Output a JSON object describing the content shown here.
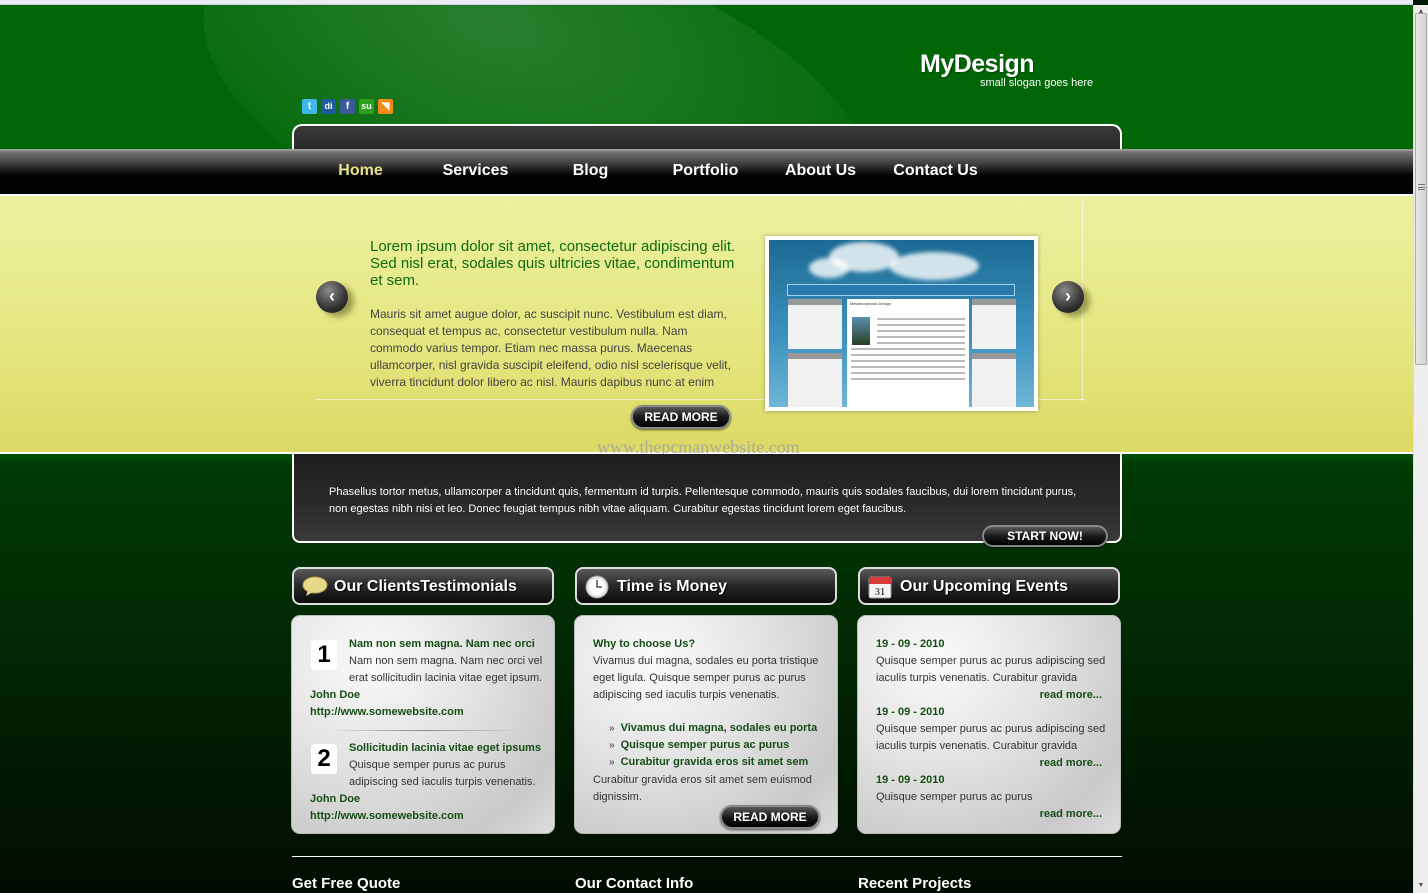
{
  "header": {
    "site_name": "MyDesign",
    "slogan": "small slogan goes here",
    "social_icons": [
      {
        "name": "twitter-icon",
        "glyph": "t",
        "color": "#3fb8e8"
      },
      {
        "name": "digg-icon",
        "glyph": "di",
        "color": "#1d5a9e"
      },
      {
        "name": "facebook-icon",
        "glyph": "f",
        "color": "#3b5998"
      },
      {
        "name": "stumbleupon-icon",
        "glyph": "su",
        "color": "#2f9f1e"
      },
      {
        "name": "rss-icon",
        "glyph": "◥",
        "color": "#f28b14"
      }
    ]
  },
  "nav": {
    "items": [
      {
        "label": "Home",
        "active": true
      },
      {
        "label": "Services"
      },
      {
        "label": "Blog"
      },
      {
        "label": "Portfolio"
      },
      {
        "label": "About Us"
      },
      {
        "label": "Contact Us"
      }
    ]
  },
  "slider": {
    "prev_icon": "‹",
    "next_icon": "›",
    "title": "Lorem ipsum dolor sit amet, consectetur adipiscing elit. Sed nisl erat, sodales quis ultricies vitae, condimentum et sem.",
    "body": "Mauris sit amet augue dolor, ac suscipit nunc. Vestibulum est diam, consequat et tempus ac, consectetur vestibulum nulla. Nam commodo varius tempor. Etiam nec massa purus. Maecenas ullamcorper, nisl gravida suscipit eleifend, odio nisl scelerisque velit, viverra tincidunt dolor libero ac nisl. Mauris dapibus nunc at enim",
    "read_more": "READ MORE",
    "thumb_title": "Metamorphosis Design"
  },
  "watermark": "www.thepcmanwebsite.com",
  "promo": {
    "text": "Phasellus tortor metus, ullamcorper a tincidunt quis, fermentum id turpis. Pellentesque commodo, mauris quis sodales faucibus, dui lorem tincidunt purus, non egestas nibh nisi et leo. Donec feugiat tempus nibh vitae aliquam. Curabitur egestas tincidunt lorem eget faucibus.",
    "button": "START NOW!"
  },
  "testimonials": {
    "title": "Our ClientsTestimonials",
    "items": [
      {
        "number": "1",
        "heading": "Nam non sem magna. Nam nec orci",
        "text": "Nam non sem magna. Nam nec orci vel erat sollicitudin lacinia vitae eget ipsum.",
        "author": "John Doe",
        "url": "http://www.somewebsite.com"
      },
      {
        "number": "2",
        "heading": "Sollicitudin lacinia vitae eget ipsums",
        "text": "Quisque semper purus ac purus adipiscing sed iaculis turpis venenatis.",
        "author": "John Doe",
        "url": "http://www.somewebsite.com"
      }
    ]
  },
  "time": {
    "title": "Time is Money",
    "subheading": "Why to choose Us?",
    "intro": "Vivamus dui magna, sodales eu porta tristique eget ligula. Quisque semper purus ac purus adipiscing sed iaculis turpis venenatis.",
    "bullets": [
      "Vivamus dui magna, sodales eu porta",
      "Quisque semper purus ac purus",
      "Curabitur gravida eros sit amet sem"
    ],
    "outro": "Curabitur gravida eros sit amet sem euismod dignissim.",
    "button": "READ MORE"
  },
  "events": {
    "title": "Our Upcoming Events",
    "calendar_day": "31",
    "items": [
      {
        "date": "19 - 09 - 2010",
        "text": "Quisque semper purus ac purus adipiscing sed iaculis turpis venenatis. Curabitur gravida",
        "link": "read more..."
      },
      {
        "date": "19 - 09 - 2010",
        "text": "Quisque semper purus ac purus adipiscing sed iaculis turpis venenatis. Curabitur gravida",
        "link": "read more..."
      },
      {
        "date": "19 - 09 - 2010",
        "text": "Quisque semper purus ac purus",
        "link": "read more..."
      }
    ]
  },
  "footer": {
    "headings": [
      "Get Free Quote",
      "Our Contact Info",
      "Recent Projects"
    ]
  },
  "scrollbar": {
    "up": "▲",
    "down": "▼"
  }
}
